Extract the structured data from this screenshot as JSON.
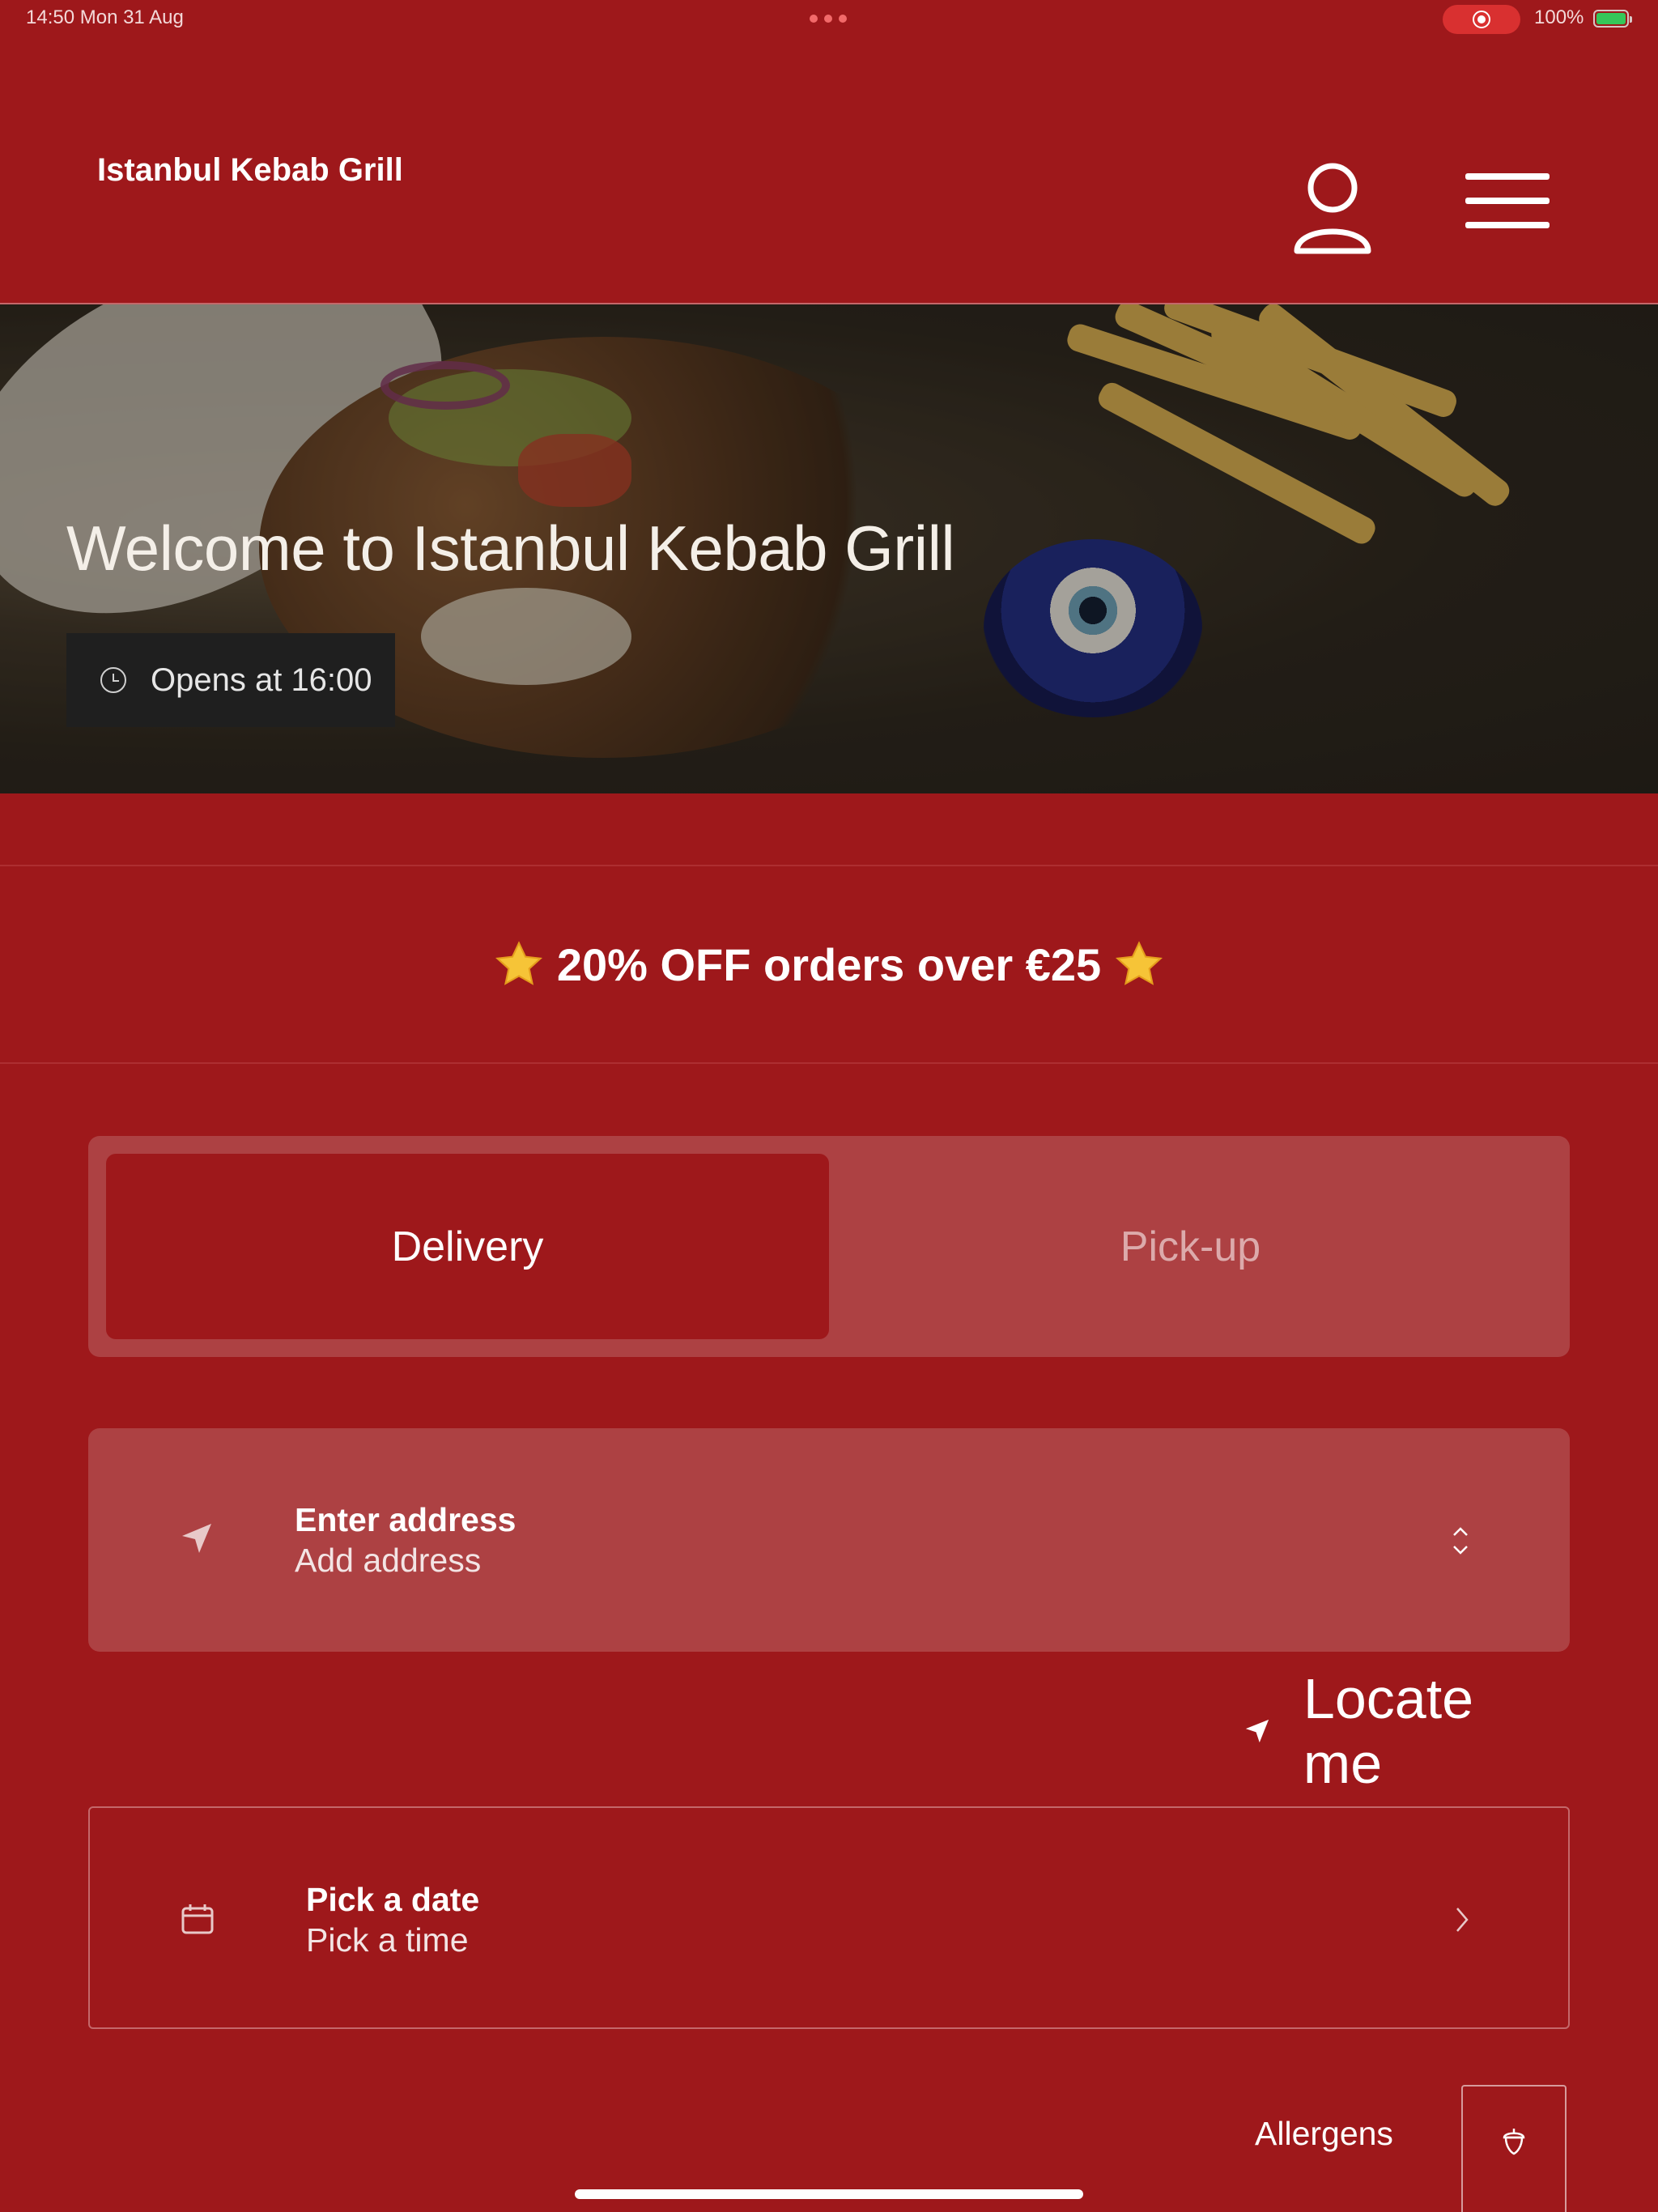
{
  "status_bar": {
    "time_date": "14:50   Mon 31 Aug",
    "battery": "100%"
  },
  "header": {
    "brand": "Istanbul Kebab Grill",
    "icons": [
      "user-icon",
      "hamburger-menu-icon"
    ]
  },
  "hero": {
    "title": "Welcome to Istanbul Kebab Grill",
    "opening": "Opens at 16:00"
  },
  "promo": {
    "text": "20% OFF orders over €25"
  },
  "order_mode": {
    "options": [
      "Delivery",
      "Pick-up"
    ],
    "selected": "Delivery"
  },
  "address": {
    "title": "Enter address",
    "subtitle": "Add address"
  },
  "locate": {
    "label": "Locate me"
  },
  "schedule": {
    "title": "Pick a date",
    "subtitle": "Pick a time"
  },
  "allergens": {
    "label": "Allergens"
  },
  "colors": {
    "brand_red": "#9e181b",
    "panel_red": "#ad4143",
    "badge_dark": "#1f1f1f"
  }
}
